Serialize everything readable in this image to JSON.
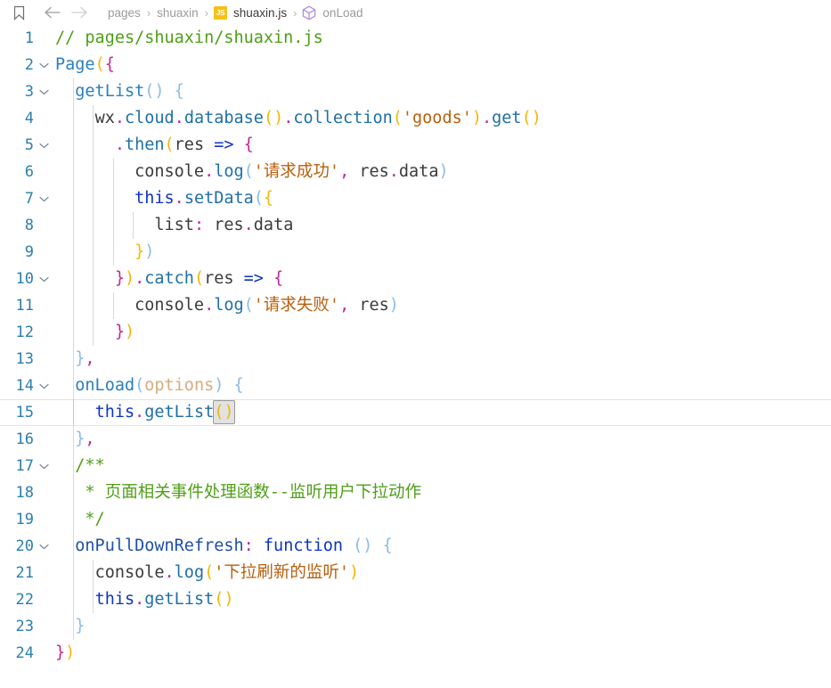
{
  "breadcrumb": {
    "bookmark_icon": "bookmark-icon",
    "back_icon": "arrow-left-icon",
    "forward_icon": "arrow-right-icon",
    "segments": [
      {
        "label": "pages",
        "kind": "folder"
      },
      {
        "label": "shuaxin",
        "kind": "folder"
      },
      {
        "label": "shuaxin.js",
        "kind": "file",
        "badge": "JS"
      },
      {
        "label": "onLoad",
        "kind": "symbol",
        "icon": "cube-icon"
      }
    ],
    "separator": "›"
  },
  "editor": {
    "language": "javascript",
    "file_name": "shuaxin.js",
    "active_line": 15,
    "total_lines": 24,
    "fold_lines": [
      2,
      3,
      5,
      7,
      10,
      14,
      17,
      20
    ],
    "line_numbers": [
      "1",
      "2",
      "3",
      "4",
      "5",
      "6",
      "7",
      "8",
      "9",
      "10",
      "11",
      "12",
      "13",
      "14",
      "15",
      "16",
      "17",
      "18",
      "19",
      "20",
      "21",
      "22",
      "23",
      "24"
    ],
    "lines": [
      {
        "n": 1,
        "text": "// pages/shuaxin/shuaxin.js"
      },
      {
        "n": 2,
        "text": "Page({"
      },
      {
        "n": 3,
        "text": "  getList() {"
      },
      {
        "n": 4,
        "text": "    wx.cloud.database().collection('goods').get()"
      },
      {
        "n": 5,
        "text": "      .then(res => {"
      },
      {
        "n": 6,
        "text": "        console.log('请求成功', res.data)"
      },
      {
        "n": 7,
        "text": "        this.setData({"
      },
      {
        "n": 8,
        "text": "          list: res.data"
      },
      {
        "n": 9,
        "text": "        })"
      },
      {
        "n": 10,
        "text": "      }).catch(res => {"
      },
      {
        "n": 11,
        "text": "        console.log('请求失败', res)"
      },
      {
        "n": 12,
        "text": "      })"
      },
      {
        "n": 13,
        "text": "  },"
      },
      {
        "n": 14,
        "text": "  onLoad(options) {"
      },
      {
        "n": 15,
        "text": "    this.getList()"
      },
      {
        "n": 16,
        "text": "  },"
      },
      {
        "n": 17,
        "text": "  /**"
      },
      {
        "n": 18,
        "text": "   * 页面相关事件处理函数--监听用户下拉动作"
      },
      {
        "n": 19,
        "text": "   */"
      },
      {
        "n": 20,
        "text": "  onPullDownRefresh: function () {"
      },
      {
        "n": 21,
        "text": "    console.log('下拉刷新的监听')"
      },
      {
        "n": 22,
        "text": "    this.getList()"
      },
      {
        "n": 23,
        "text": "  }"
      },
      {
        "n": 24,
        "text": "})"
      }
    ],
    "tokens": {
      "l1_comment": "// pages/shuaxin/shuaxin.js",
      "l2_page": "Page",
      "l2_paren": "(",
      "l2_brace": "{",
      "l3_getlist": "getList",
      "l3_parens": "()",
      "l3_brace": "{",
      "l4_wx": "wx",
      "l4_dot1": ".",
      "l4_cloud": "cloud",
      "l4_dot2": ".",
      "l4_database": "database",
      "l4_dbparens": "()",
      "l4_dot3": ".",
      "l4_collection": "collection",
      "l4_open": "(",
      "l4_goods": "'goods'",
      "l4_close": ")",
      "l4_dot4": ".",
      "l4_get": "get",
      "l4_getparens": "()",
      "l5_dot": ".",
      "l5_then": "then",
      "l5_open": "(",
      "l5_res": "res",
      "l5_arrow": " => ",
      "l5_brace": "{",
      "l6_console": "console",
      "l6_dot": ".",
      "l6_log": "log",
      "l6_open": "(",
      "l6_str": "'请求成功'",
      "l6_comma": ", ",
      "l6_res": "res",
      "l6_dot2": ".",
      "l6_data": "data",
      "l6_close": ")",
      "l7_this": "this",
      "l7_dot": ".",
      "l7_setdata": "setData",
      "l7_open": "(",
      "l7_brace": "{",
      "l8_list": "list",
      "l8_colon": ": ",
      "l8_res": "res",
      "l8_dot": ".",
      "l8_data": "data",
      "l9_brace": "}",
      "l9_paren": ")",
      "l10_brace": "}",
      "l10_paren": ")",
      "l10_dot": ".",
      "l10_catch": "catch",
      "l10_open": "(",
      "l10_res": "res",
      "l10_arrow": " => ",
      "l10_brace2": "{",
      "l11_str": "'请求失败'",
      "l11_res": "res",
      "l12_brace": "}",
      "l12_paren": ")",
      "l13_brace": "}",
      "l13_comma": ",",
      "l14_onload": "onLoad",
      "l14_open": "(",
      "l14_options": "options",
      "l14_close": ")",
      "l14_brace": "{",
      "l15_this": "this",
      "l15_dot": ".",
      "l15_getlist": "getList",
      "l15_parens": "()",
      "l16_brace": "}",
      "l16_comma": ",",
      "l17_comment": "/**",
      "l18_star": " * ",
      "l18_text": "页面相关事件处理函数--监听用户下拉动作",
      "l19_comment": " */",
      "l20_name": "onPullDownRefresh",
      "l20_colon": ":",
      "l20_function": " function ",
      "l20_parens": "()",
      "l20_brace": " {",
      "l21_str": "'下拉刷新的监听'",
      "l22_this": "this",
      "l22_dot": ".",
      "l22_getlist": "getList",
      "l22_parens": "()",
      "l23_brace": "}",
      "l24_brace": "}",
      "l24_paren": ")"
    }
  },
  "colors": {
    "background": "#ffffff",
    "line_number": "#2b7fad",
    "comment": "#4f9e18",
    "keyword": "#0f34c4",
    "function": "#2a7fbd",
    "string": "#b8600d",
    "parameter": "#d9ab7b",
    "bracket_yellow": "#f2b705",
    "bracket_purple": "#c3269b",
    "bracket_blue": "#8bbbe6",
    "js_badge": "#f5c116",
    "symbol_icon": "#b08cd6",
    "active_line_border": "#e4e4e4"
  }
}
